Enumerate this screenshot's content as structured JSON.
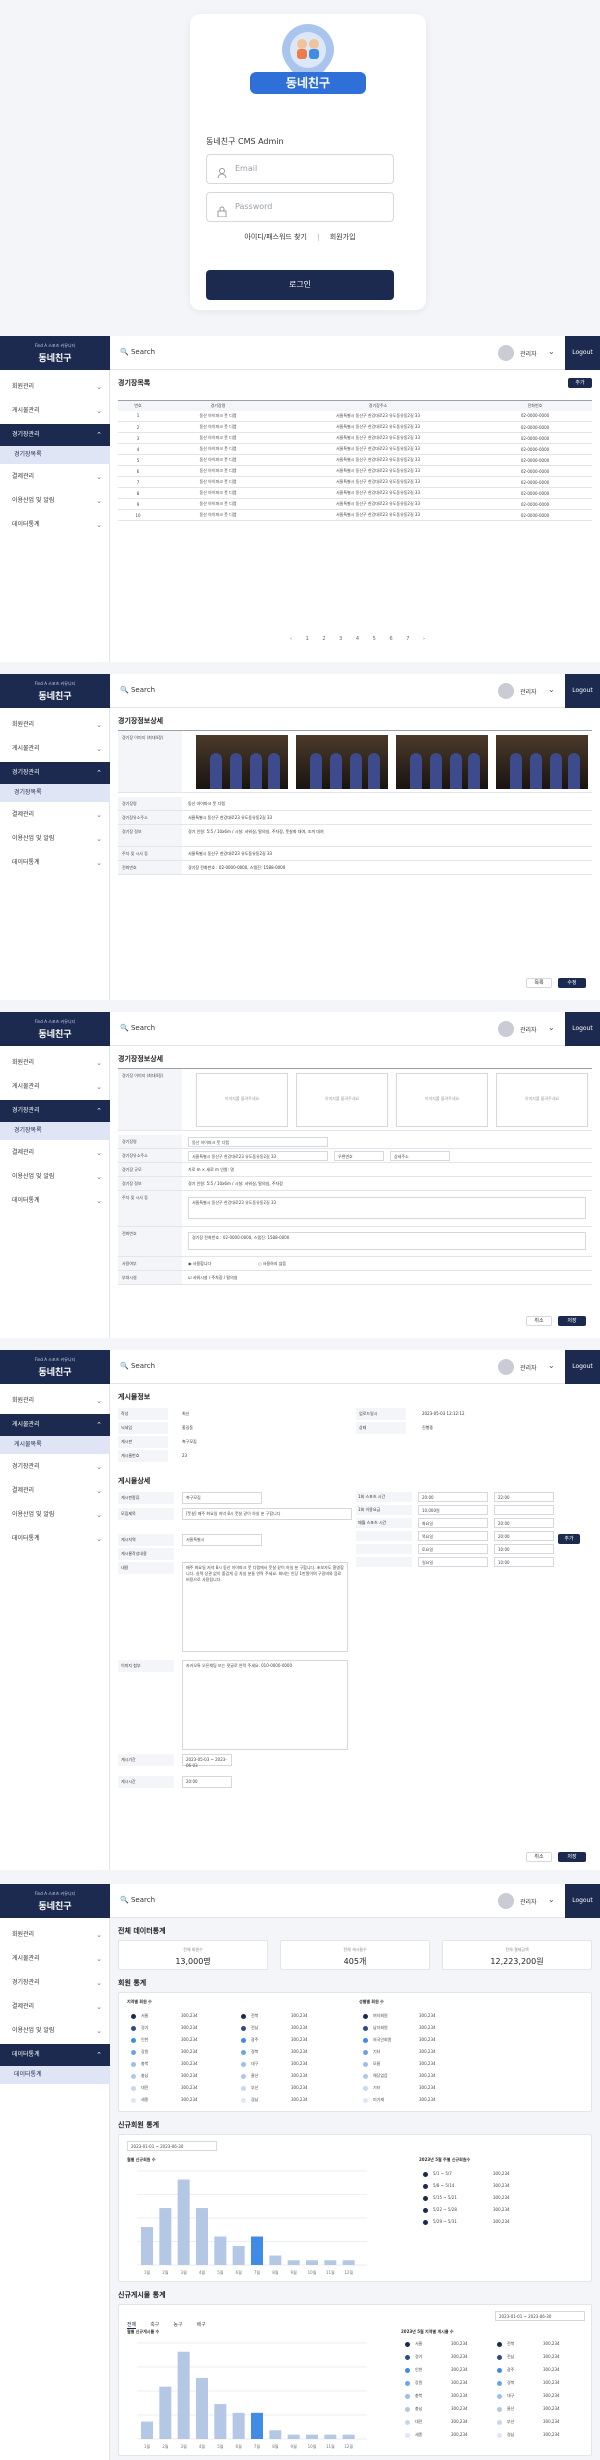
{
  "login": {
    "logo_text": "동네친구",
    "title": "동네친구 CMS Admin",
    "email_placeholder": "Email",
    "password_placeholder": "Password",
    "find_link": "아이디/패스워드 찾기",
    "separator": "|",
    "signup_link": "회원가입",
    "login_button": "로그인"
  },
  "shell": {
    "brand_sub": "Find A 스포츠 커뮤니티",
    "brand": "동네친구",
    "search": "Search",
    "admin": "관리자",
    "logout": "Logout",
    "menu": [
      "회원관리",
      "게시물관리",
      "경기장관리",
      "결제관리",
      "이용산업 및 알림",
      "데이터통계"
    ],
    "sub_games": "경기장목록",
    "sub_posts": "게시물목록",
    "sub_data": "데이터통계"
  },
  "list": {
    "title": "경기장목록",
    "add_button": "추가",
    "headers": [
      "번호",
      "경기장명",
      "경기장주소",
      "전화번호"
    ],
    "rows": [
      [
        "1",
        "동산 아이파크 풋 디랩",
        "서울특별시 동산구 한강대로23 유도동유동2길 33",
        "02-0000-0000"
      ],
      [
        "2",
        "동산 아이파크 풋 디랩",
        "서울특별시 동산구 한강대로23 유도동유동2길 33",
        "02-0000-0000"
      ],
      [
        "3",
        "동산 아이파크 풋 디랩",
        "서울특별시 동산구 한강대로23 유도동유동2길 33",
        "02-0000-0000"
      ],
      [
        "4",
        "동산 아이파크 풋 디랩",
        "서울특별시 동산구 한강대로23 유도동유동2길 33",
        "02-0000-0000"
      ],
      [
        "5",
        "동산 아이파크 풋 디랩",
        "서울특별시 동산구 한강대로23 유도동유동2길 33",
        "02-0000-0000"
      ],
      [
        "6",
        "동산 아이파크 풋 디랩",
        "서울특별시 동산구 한강대로23 유도동유동2길 33",
        "02-0000-0000"
      ],
      [
        "7",
        "동산 아이파크 풋 디랩",
        "서울특별시 동산구 한강대로23 유도동유동2길 33",
        "02-0000-0000"
      ],
      [
        "8",
        "동산 아이파크 풋 디랩",
        "서울특별시 동산구 한강대로23 유도동유동2길 33",
        "02-0000-0000"
      ],
      [
        "9",
        "동산 아이파크 풋 디랩",
        "서울특별시 동산구 한강대로23 유도동유동2길 33",
        "02-0000-0000"
      ],
      [
        "10",
        "동산 아이파크 풋 디랩",
        "서울특별시 동산구 한강대로23 유도동유동2길 33",
        "02-0000-0000"
      ]
    ],
    "pager": "‹ 1 2 3 4 5 6 7 ›"
  },
  "detail": {
    "title": "경기장정보상세",
    "photo_label": "경기장 이미지 (최대4장)",
    "labels": [
      "경기장명",
      "경기장유소주소",
      "경기장 정보",
      "주차 및 시사 등",
      "전화번호"
    ],
    "values": [
      "동산 아이파크 풋 디랩",
      "서울특별시 동산구 한강대로23 유도동유동2길 33",
      "경기 인원: 5:5 / 10x6m / 시설: 샤워실, 탈의실, 주차장, 풋살화 대여, 조끼 대여",
      "서울특별시 동산구 한강대로23 유도동유동2길 33",
      "경기장 전화번호 : 02-0000-0000, 스탭진: 1588-0000"
    ],
    "list_button": "목록",
    "edit_button": "수정"
  },
  "edit": {
    "title": "경기장정보상세",
    "photo_label": "경기장 이미지 (최대4장)",
    "photo_hint": "이미지를 올려주세요",
    "labels": [
      "경기장명",
      "경기장유소주소",
      "경기장 규모",
      "경기장 정보",
      "주차 및 시사 등",
      "전화번호",
      "사용여부",
      "부대시설"
    ],
    "name": "동산 아이파크 풋 디랩",
    "address": "서울특별시 동산구 한강대로23 유도동유동2길 33",
    "zip": "우편번호",
    "detail_addr": "상세주소",
    "size": "가로  m  ×  세로  m      인원:  명",
    "info": "경기 인원: 5:5 / 10x6m / 시설: 샤워실, 탈의실, 주차장",
    "parking": "서울특별시 동산구 한강대로23 유도동유동2길 33",
    "phone": "경기장 전화번호 : 02-0000-0000, 스탭진: 1588-0000",
    "use_yes": "사용합니다",
    "use_no": "사용하지 않음",
    "facility": "샤워시설 / 주차장 / 탈의실",
    "cancel": "취소",
    "save": "저장"
  },
  "post": {
    "title": "게시물정보",
    "kv": [
      [
        "작성",
        "최신"
      ],
      [
        "닉네임",
        "홍길동"
      ],
      [
        "게시판",
        "축구모집"
      ],
      [
        "게시물번호",
        "23"
      ]
    ],
    "date_label": "업로드일시",
    "date": "2023-05-03 12:12:12",
    "status_label": "상태",
    "status": "진행중",
    "section2": "게시물상세",
    "fields": [
      "게시판종류",
      "모집제목",
      "게시지역",
      "게시물작성내용",
      "내용",
      "이미지 첨부",
      "게시기간",
      "게시시간"
    ],
    "board": "축구모집",
    "subject": "[풋살] 매주 화요일 저녁 8시 풋살 같이 하실 분 구합니다",
    "region": "서울특별시",
    "body": "매주 화요일 저녁 8시 동산 아이파크 풋 디랩에서 풋살 같이 하실 분 구합니다. 초보자도 환영합니다. 실력 상관 없이 즐겁게 공 차실 분들 연락 주세요. 회비는 인당 1만원이며 구장비와 음료 비용으로 사용됩니다.",
    "contact": "카카오톡 오픈채팅 또는 댓글로 연락 주세요. 010-0000-0000",
    "period": "2023-05-03 ~ 2023-06-03",
    "time": "20:00",
    "side_rows": [
      [
        "1회 스포츠 시간",
        "20:00",
        "22:00"
      ],
      [
        "1회 이용요금",
        "10,000원",
        ""
      ],
      [
        "매월 스포츠 시간",
        "화요일",
        "20:00"
      ],
      [
        "",
        "목요일",
        "20:00"
      ],
      [
        "",
        "토요일",
        "10:00"
      ],
      [
        "",
        "일요일",
        "10:00"
      ]
    ],
    "add": "추가",
    "cancel": "취소",
    "save": "저장"
  },
  "stats": {
    "title": "전체 데이터통계",
    "summary": [
      [
        "전체 회원수",
        "13,000명"
      ],
      [
        "전체 게시물수",
        "405개"
      ],
      [
        "전체 결제금액",
        "12,223,200원"
      ]
    ],
    "members_title": "회원 통계",
    "region_title": "지역별 회원 수",
    "gender_title": "성별별 회원 수",
    "regions": [
      "서울",
      "경기",
      "인천",
      "강원",
      "충북",
      "충남",
      "대전",
      "세종",
      "전북",
      "전남",
      "광주",
      "경북",
      "대구",
      "울산",
      "부산",
      "경남"
    ],
    "region_values": [
      "300,234",
      "300,234",
      "300,234",
      "300,234",
      "300,234",
      "300,234",
      "300,234",
      "300,234",
      "300,234",
      "300,234",
      "300,234",
      "300,234",
      "300,234",
      "300,234",
      "300,234",
      "300,234"
    ],
    "region_colors": [
      "#1b2a4e",
      "#2f4a86",
      "#3f8be6",
      "#6aa3ea",
      "#98bff0",
      "#b4c8e6",
      "#c9d7ee",
      "#dfe7f5",
      "#1b2a4e",
      "#2f4a86",
      "#3f8be6",
      "#6aa3ea",
      "#98bff0",
      "#b4c8e6",
      "#c9d7ee",
      "#dfe7f5"
    ],
    "genders": [
      "여자회원",
      "남자회원",
      "외국인회원",
      "기타",
      "모름",
      "해당없음",
      "기타",
      "미기재"
    ],
    "gender_values": [
      "300,234",
      "300,234",
      "300,234",
      "300,234",
      "300,234",
      "300,234",
      "300,234",
      "300,234"
    ],
    "new_title": "신규회원 통계",
    "new_date": "2023-01-01 ~ 2023-06-30",
    "new_chart_title": "월별 신규회원 수",
    "new_side_title": "2023년 5월 주별 신규회원수",
    "new_side_rows": [
      [
        "5/1 ~ 5/7",
        "300,234"
      ],
      [
        "5/8 ~ 5/14",
        "300,234"
      ],
      [
        "5/15 ~ 5/21",
        "300,234"
      ],
      [
        "5/22 ~ 5/28",
        "300,234"
      ],
      [
        "5/29 ~ 5/31",
        "300,234"
      ]
    ],
    "post_title": "신규게시물 통계",
    "post_tabs": [
      "전체",
      "축구",
      "농구",
      "배구"
    ],
    "post_date": "2023-01-01 ~ 2023-06-30",
    "post_chart_title": "월별 신규게시물 수",
    "post_side_title": "2023년 5월 지역별 게시물 수",
    "post_side_values": [
      "300,234",
      "300,234",
      "300,234",
      "300,234",
      "300,234",
      "300,234",
      "300,234",
      "300,234",
      "300,234",
      "300,234",
      "300,234",
      "300,234",
      "300,234",
      "300,234",
      "300,234",
      "300,234"
    ]
  },
  "chart_data": [
    {
      "type": "bar",
      "title": "월별 신규회원 수",
      "categories": [
        "1월",
        "2월",
        "3월",
        "4월",
        "5월",
        "6월",
        "7월",
        "8월",
        "9월",
        "10월",
        "11월",
        "12월"
      ],
      "values": [
        40,
        60,
        90,
        60,
        30,
        20,
        30,
        10,
        5,
        5,
        5,
        5
      ],
      "highlight_index": 6
    },
    {
      "type": "bar",
      "title": "월별 신규게시물 수",
      "categories": [
        "1월",
        "2월",
        "3월",
        "4월",
        "5월",
        "6월",
        "7월",
        "8월",
        "9월",
        "10월",
        "11월",
        "12월"
      ],
      "values": [
        20,
        60,
        100,
        70,
        40,
        30,
        30,
        10,
        5,
        5,
        5,
        5
      ],
      "highlight_index": 6
    }
  ]
}
